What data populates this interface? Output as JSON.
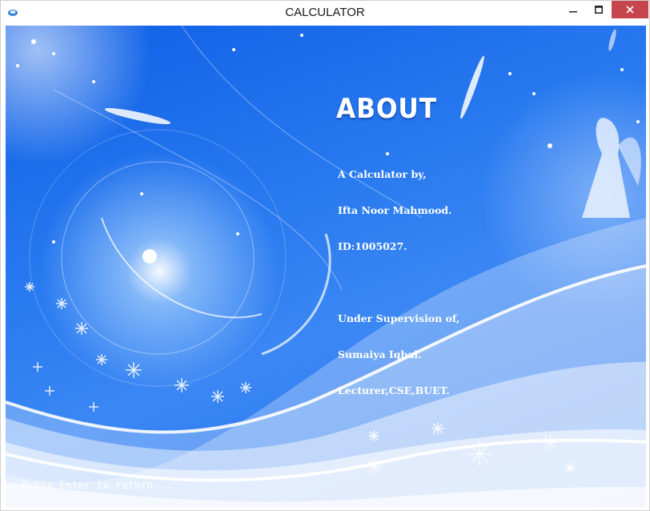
{
  "window": {
    "title": "CALCULATOR",
    "icons": {
      "app": "app-icon",
      "minimize": "minimize-icon",
      "maximize": "maximize-icon",
      "close": "close-icon"
    },
    "colors": {
      "close_button": "#c7464d",
      "titlebar": "#ffffff"
    }
  },
  "about": {
    "heading": "ABOUT",
    "lines": [
      "A Calculator by,",
      "Ifta Noor Mahmood.",
      "ID:1005027.",
      "Under Supervision of,",
      "Sumaiya Iqbal.",
      "Lecturer,CSE,BUET."
    ]
  },
  "footer": {
    "prompt": "Press Enter to return..."
  },
  "colors": {
    "background": "#1f70ec",
    "text": "#ffffff"
  }
}
